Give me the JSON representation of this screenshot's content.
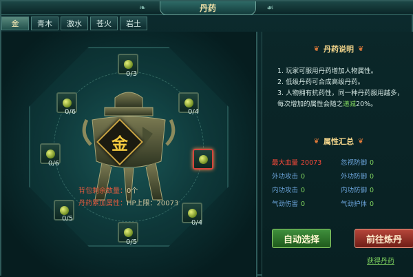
{
  "window": {
    "title": "丹药"
  },
  "tabs": [
    "金",
    "青木",
    "激水",
    "苍火",
    "岩土"
  ],
  "center": {
    "element_glyph": "金"
  },
  "slots": [
    {
      "count": "0/3"
    },
    {
      "count": "0/6"
    },
    {
      "count": "0/4"
    },
    {
      "count": "0/6"
    },
    {
      "count": "0/5"
    },
    {
      "count": "0/4"
    },
    {
      "count": "0/5"
    }
  ],
  "status": {
    "bag_remaining_label": "背包剩余数量：",
    "bag_remaining_value": "0个",
    "accum_label": "丹药累加属性：",
    "accum_value": "HP上限：20073"
  },
  "rules_section": {
    "title": "丹药说明",
    "line1": "1. 玩家可服用丹药增加人物属性。",
    "line2": "2. 低级丹药可合成高级丹药。",
    "line3a": "3. 人物拥有抗药性，同一种丹药服用越多，",
    "line3b": "每次增加的属性会随之",
    "line3_em": "递减",
    "line3_end": "20%。"
  },
  "attr_section": {
    "title": "属性汇总",
    "items": [
      {
        "label": "最大血量",
        "value": "20073",
        "highlight": true
      },
      {
        "label": "忽视防御",
        "value": "0"
      },
      {
        "label": "外功攻击",
        "value": "0"
      },
      {
        "label": "外功防御",
        "value": "0"
      },
      {
        "label": "内功攻击",
        "value": "0"
      },
      {
        "label": "内功防御",
        "value": "0"
      },
      {
        "label": "气劲伤害",
        "value": "0"
      },
      {
        "label": "气劲护体",
        "value": "0"
      }
    ]
  },
  "buttons": {
    "auto_select": "自动选择",
    "go_refine": "前往炼丹"
  },
  "link": {
    "get_pills": "获得丹药"
  },
  "colors": {
    "green": "#7fd35f",
    "red": "#ff4a3a",
    "blue": "#6aa2d8",
    "gold": "#f2d48a"
  }
}
